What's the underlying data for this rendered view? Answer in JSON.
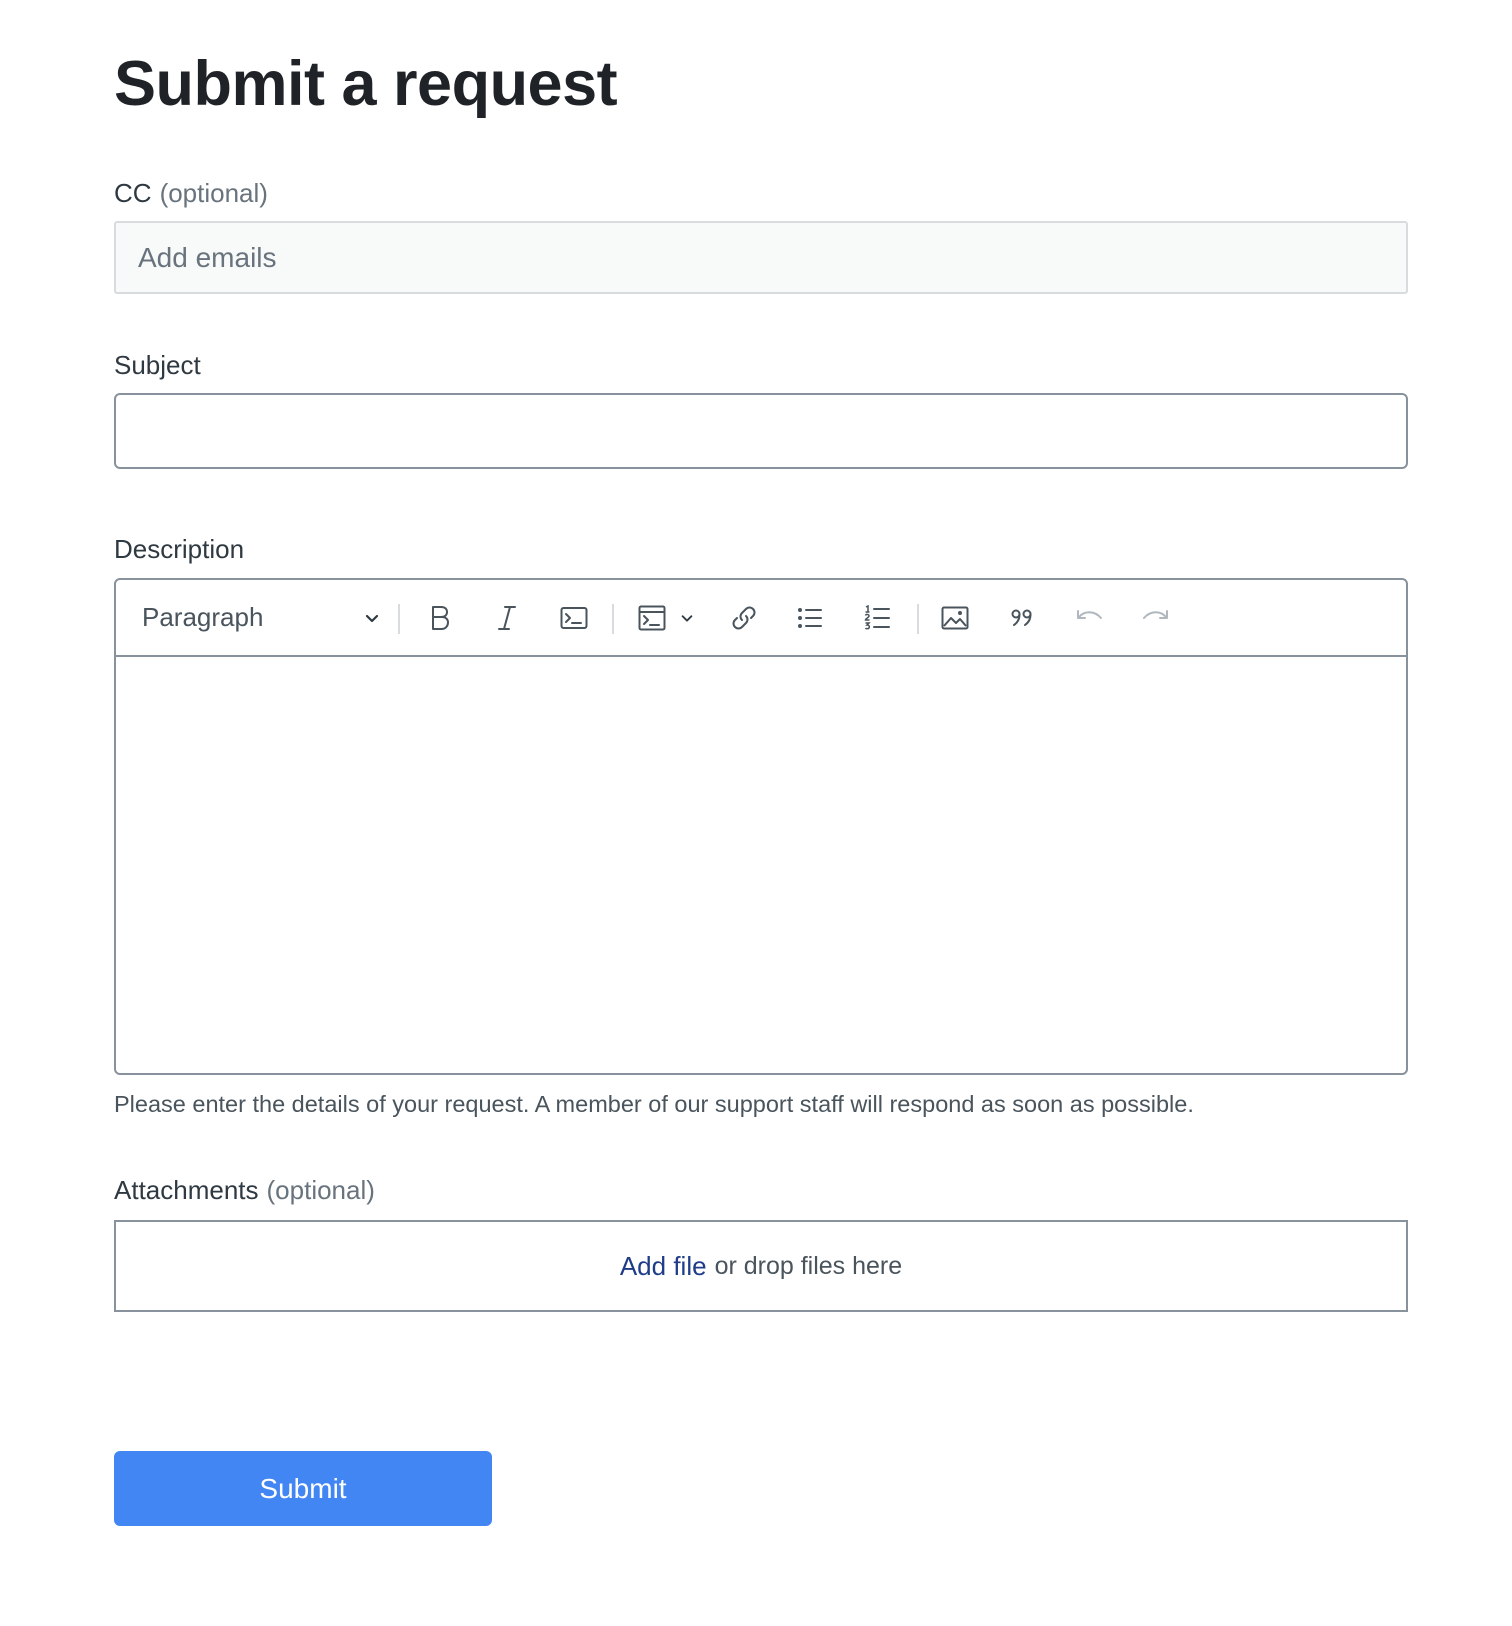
{
  "page": {
    "title": "Submit a request"
  },
  "cc": {
    "label": "CC",
    "optional": "(optional)",
    "placeholder": "Add emails",
    "value": ""
  },
  "subject": {
    "label": "Subject",
    "value": ""
  },
  "description": {
    "label": "Description",
    "hint": "Please enter the details of your request. A member of our support staff will respond as soon as possible.",
    "toolbar": {
      "block_format": "Paragraph",
      "icons": [
        "bold-icon",
        "italic-icon",
        "inline-code-icon",
        "code-block-icon",
        "link-icon",
        "bulleted-list-icon",
        "numbered-list-icon",
        "image-icon",
        "blockquote-icon",
        "undo-icon",
        "redo-icon"
      ]
    },
    "value": ""
  },
  "attachments": {
    "label": "Attachments",
    "optional": "(optional)",
    "add_file": "Add file",
    "drop_text": "or drop files here"
  },
  "submit": {
    "label": "Submit"
  },
  "colors": {
    "accent": "#4286f4",
    "link": "#1f3c88",
    "title": "#1f2328",
    "muted": "#68737d",
    "border": "#87929d"
  }
}
